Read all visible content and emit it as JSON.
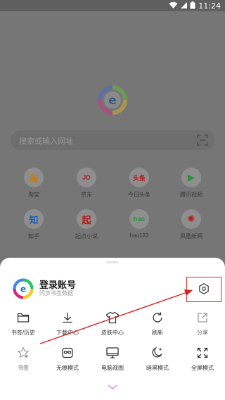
{
  "status_bar": {
    "time": "11:24"
  },
  "search": {
    "placeholder": "搜索或输入网址"
  },
  "shortcuts": [
    {
      "glyph": "淘",
      "label": "淘宝",
      "color": "#c8780a"
    },
    {
      "glyph": "JD",
      "label": "京东",
      "color": "#b31b1b"
    },
    {
      "glyph": "头条",
      "label": "今日头条",
      "color": "#b31b1b"
    },
    {
      "glyph": "▶",
      "label": "腾讯视频",
      "color": "#2f8f3f"
    },
    {
      "glyph": "知",
      "label": "知乎",
      "color": "#1a5fb4"
    },
    {
      "glyph": "起",
      "label": "起点小说",
      "color": "#b31b1b"
    },
    {
      "glyph": "hao",
      "label": "hao123",
      "color": "#2f8f3f"
    },
    {
      "glyph": "✺",
      "label": "凤凰新闻",
      "color": "#b31b1b"
    }
  ],
  "account": {
    "title": "登录账号",
    "subtitle": "同步书签数据"
  },
  "menu": [
    {
      "label": "书签/历史",
      "icon": "folder-icon"
    },
    {
      "label": "下载中心",
      "icon": "download-icon"
    },
    {
      "label": "皮肤中心",
      "icon": "shirt-icon"
    },
    {
      "label": "刷新",
      "icon": "refresh-icon"
    },
    {
      "label": "分享",
      "icon": "share-icon"
    },
    {
      "label": "书签",
      "icon": "star-icon"
    },
    {
      "label": "无痕模式",
      "icon": "incognito-icon"
    },
    {
      "label": "电脑视图",
      "icon": "desktop-icon"
    },
    {
      "label": "暗黑模式",
      "icon": "moon-icon"
    },
    {
      "label": "全屏模式",
      "icon": "fullscreen-icon"
    }
  ],
  "colors": {
    "annotation_red": "#e02020",
    "logo_blue": "#1a73c9"
  }
}
